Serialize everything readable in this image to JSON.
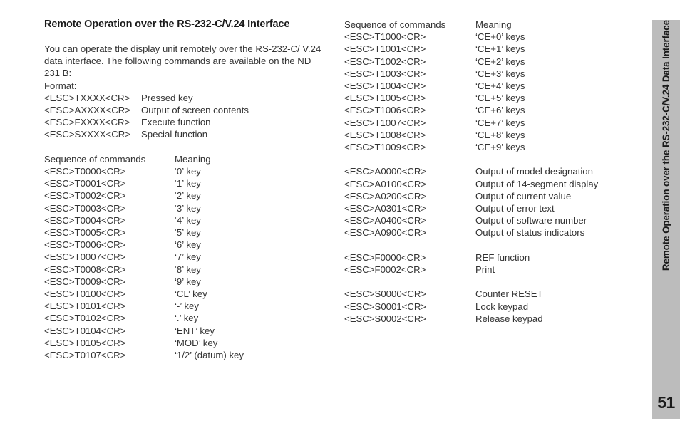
{
  "document": {
    "section_title": "Remote Operation over the RS-232-C/V.24 Interface",
    "intro_paragraph": "You can operate the display unit remotely over the RS-232-C/ V.24 data interface. The following commands are available on the ND 231 B:",
    "format_label": "Format:"
  },
  "format_block": {
    "rows": [
      {
        "command": "<ESC>TXXXX<CR>",
        "meaning": "Pressed key"
      },
      {
        "command": "<ESC>AXXXX<CR>",
        "meaning": "Output of screen contents"
      },
      {
        "command": "<ESC>FXXXX<CR>",
        "meaning": "Execute function"
      },
      {
        "command": "<ESC>SXXXX<CR>",
        "meaning": "Special function"
      }
    ]
  },
  "left_table": {
    "header": {
      "command": "Sequence of commands",
      "meaning": "Meaning"
    },
    "rows": [
      {
        "command": "<ESC>T0000<CR>",
        "meaning": "‘0’ key"
      },
      {
        "command": "<ESC>T0001<CR>",
        "meaning": "‘1’ key"
      },
      {
        "command": "<ESC>T0002<CR>",
        "meaning": "‘2’ key"
      },
      {
        "command": "<ESC>T0003<CR>",
        "meaning": "‘3’ key"
      },
      {
        "command": "<ESC>T0004<CR>",
        "meaning": "‘4’ key"
      },
      {
        "command": "<ESC>T0005<CR>",
        "meaning": "‘5’ key"
      },
      {
        "command": "<ESC>T0006<CR>",
        "meaning": "‘6’ key"
      },
      {
        "command": "<ESC>T0007<CR>",
        "meaning": "‘7’ key"
      },
      {
        "command": "<ESC>T0008<CR>",
        "meaning": "‘8’ key"
      },
      {
        "command": "<ESC>T0009<CR>",
        "meaning": "‘9’ key"
      },
      {
        "command": "<ESC>T0100<CR>",
        "meaning": "‘CL’ key"
      },
      {
        "command": "<ESC>T0101<CR>",
        "meaning": "‘-’ key"
      },
      {
        "command": "<ESC>T0102<CR>",
        "meaning": "‘.’ key"
      },
      {
        "command": "<ESC>T0104<CR>",
        "meaning": "‘ENT’ key"
      },
      {
        "command": "<ESC>T0105<CR>",
        "meaning": "‘MOD’ key"
      },
      {
        "command": "<ESC>T0107<CR>",
        "meaning": "‘1/2’ (datum) key"
      }
    ]
  },
  "right_table": {
    "header": {
      "command": "Sequence of commands",
      "meaning": "Meaning"
    },
    "key_rows": [
      {
        "command": "<ESC>T1000<CR>",
        "meaning": "‘CE+0’ keys"
      },
      {
        "command": "<ESC>T1001<CR>",
        "meaning": "‘CE+1’ keys"
      },
      {
        "command": "<ESC>T1002<CR>",
        "meaning": "‘CE+2’ keys"
      },
      {
        "command": "<ESC>T1003<CR>",
        "meaning": "‘CE+3’ keys"
      },
      {
        "command": "<ESC>T1004<CR>",
        "meaning": "‘CE+4’ keys"
      },
      {
        "command": "<ESC>T1005<CR>",
        "meaning": "‘CE+5’ keys"
      },
      {
        "command": "<ESC>T1006<CR>",
        "meaning": "‘CE+6’ keys"
      },
      {
        "command": "<ESC>T1007<CR>",
        "meaning": "‘CE+7’ keys"
      },
      {
        "command": "<ESC>T1008<CR>",
        "meaning": "‘CE+8’ keys"
      },
      {
        "command": "<ESC>T1009<CR>",
        "meaning": "‘CE+9’ keys"
      }
    ],
    "output_rows": [
      {
        "command": "<ESC>A0000<CR>",
        "meaning": "Output of model designation"
      },
      {
        "command": "<ESC>A0100<CR>",
        "meaning": "Output of 14-segment display"
      },
      {
        "command": "<ESC>A0200<CR>",
        "meaning": "Output of current value"
      },
      {
        "command": "<ESC>A0301<CR>",
        "meaning": "Output of error text"
      },
      {
        "command": "<ESC>A0400<CR>",
        "meaning": "Output of software number"
      },
      {
        "command": "<ESC>A0900<CR>",
        "meaning": "Output of status indicators"
      }
    ],
    "function_rows": [
      {
        "command": "<ESC>F0000<CR>",
        "meaning": "REF function"
      },
      {
        "command": "<ESC>F0002<CR>",
        "meaning": "Print"
      }
    ],
    "special_rows": [
      {
        "command": "<ESC>S0000<CR>",
        "meaning": "Counter RESET"
      },
      {
        "command": "<ESC>S0001<CR>",
        "meaning": "Lock keypad"
      },
      {
        "command": "<ESC>S0002<CR>",
        "meaning": "Release keypad"
      }
    ]
  },
  "side_tab": {
    "label": "Remote Operation over the RS-232-C/V.24 Data Interface",
    "page_number": "51",
    "background_color": "#bcbcbc"
  }
}
